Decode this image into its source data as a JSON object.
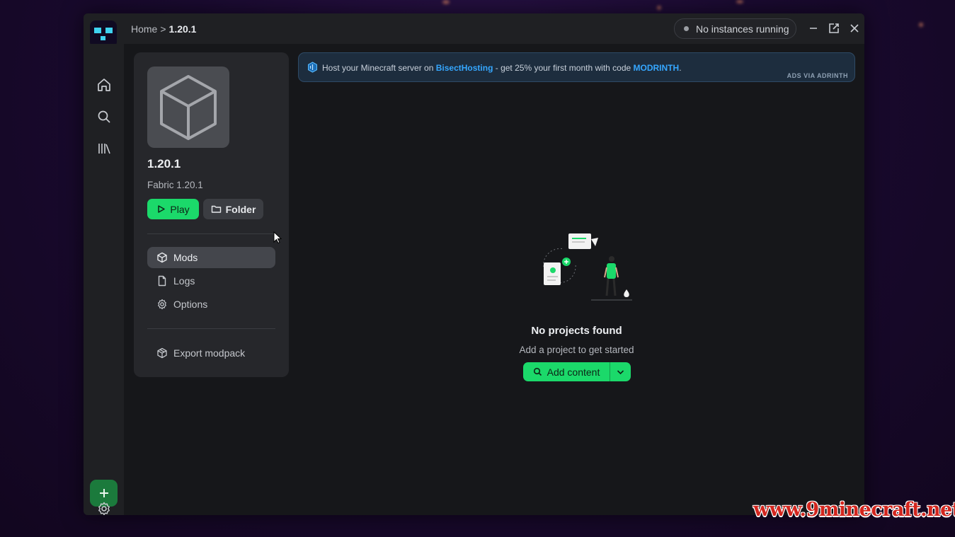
{
  "breadcrumb": {
    "home": "Home",
    "separator": ">",
    "current": "1.20.1"
  },
  "status": {
    "instances_label": "No instances running"
  },
  "sidebar": {
    "nav": [
      {
        "icon": "home-icon"
      },
      {
        "icon": "search-icon"
      },
      {
        "icon": "library-icon"
      }
    ]
  },
  "instance": {
    "name": "1.20.1",
    "loader_version": "Fabric 1.20.1",
    "play_label": "Play",
    "folder_label": "Folder",
    "menu": [
      {
        "label": "Mods",
        "icon": "cube-icon",
        "active": true
      },
      {
        "label": "Logs",
        "icon": "file-icon",
        "active": false
      },
      {
        "label": "Options",
        "icon": "gear-icon",
        "active": false
      }
    ],
    "export_label": "Export modpack"
  },
  "ad": {
    "text_before": "Host your Minecraft server on ",
    "brand": "BisectHosting",
    "text_middle": " - get 25% your first month with code ",
    "code": "MODRINTH",
    "text_after": ".",
    "tag": "ADS VIA ADRINTH"
  },
  "empty_state": {
    "title": "No projects found",
    "subtitle": "Add a project to get started",
    "button_label": "Add content"
  },
  "watermark": "www.9minecraft.net",
  "colors": {
    "accent_green": "#1bd96a",
    "link_blue": "#35a7ff",
    "logo_cyan": "#3fd3f0"
  }
}
